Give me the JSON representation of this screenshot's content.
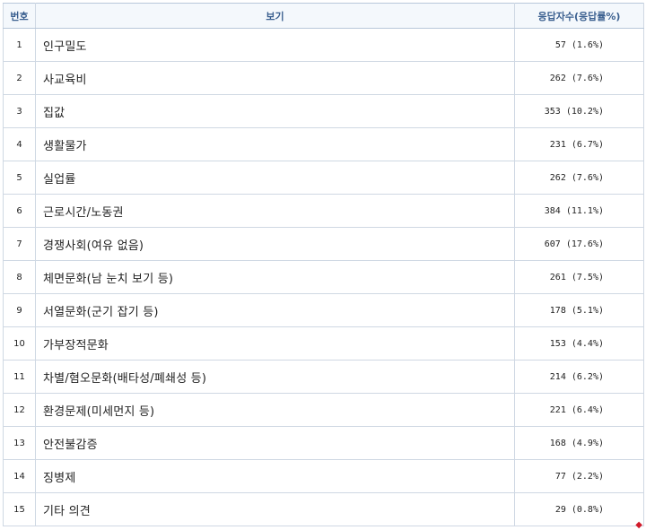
{
  "table": {
    "headers": {
      "no": "번호",
      "option": "보기",
      "count": "응답자수(응답률%)"
    },
    "rows": [
      {
        "no": "1",
        "label": "인구밀도",
        "count": "57 (1.6%)"
      },
      {
        "no": "2",
        "label": "사교육비",
        "count": "262 (7.6%)"
      },
      {
        "no": "3",
        "label": "집값",
        "count": "353 (10.2%)"
      },
      {
        "no": "4",
        "label": "생활물가",
        "count": "231 (6.7%)"
      },
      {
        "no": "5",
        "label": "실업률",
        "count": "262 (7.6%)"
      },
      {
        "no": "6",
        "label": "근로시간/노동권",
        "count": "384 (11.1%)"
      },
      {
        "no": "7",
        "label": "경쟁사회(여유 없음)",
        "count": "607 (17.6%)"
      },
      {
        "no": "8",
        "label": "체면문화(남 눈치 보기 등)",
        "count": "261 (7.5%)"
      },
      {
        "no": "9",
        "label": "서열문화(군기 잡기 등)",
        "count": "178 (5.1%)"
      },
      {
        "no": "10",
        "label": "가부장적문화",
        "count": "153 (4.4%)"
      },
      {
        "no": "11",
        "label": "차별/혐오문화(배타성/폐쇄성 등)",
        "count": "214 (6.2%)"
      },
      {
        "no": "12",
        "label": "환경문제(미세먼지 등)",
        "count": "221 (6.4%)"
      },
      {
        "no": "13",
        "label": "안전불감증",
        "count": "168 (4.9%)"
      },
      {
        "no": "14",
        "label": "징병제",
        "count": "77 (2.2%)"
      },
      {
        "no": "15",
        "label": "기타 의견",
        "count": "29 (0.8%)"
      }
    ]
  },
  "corner_mark": "◆",
  "colors": {
    "header_text": "#3a5f8f",
    "header_bg": "#f4f8fc",
    "border": "#cfd8e3",
    "corner_mark": "#d11a2a"
  }
}
